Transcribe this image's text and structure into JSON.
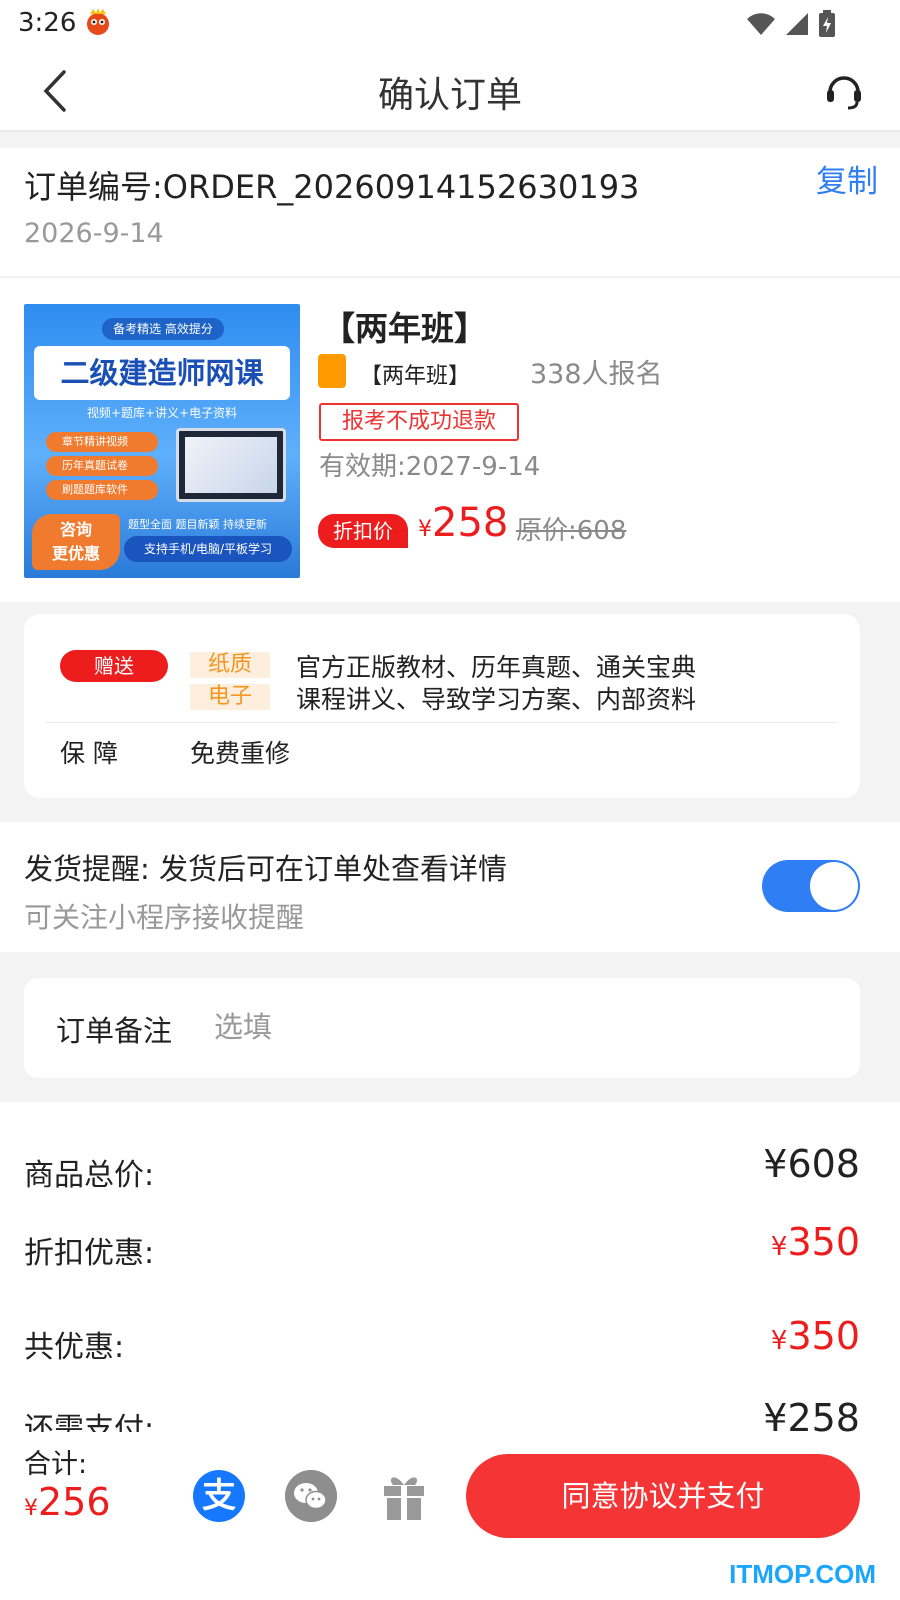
{
  "status_bar": {
    "time": "3:26"
  },
  "nav": {
    "title": "确认订单"
  },
  "order": {
    "number": "订单编号:ORDER_20260914152630193",
    "copy_label": "复制",
    "date": "2026-9-14"
  },
  "product": {
    "image": {
      "tag": "备考精选 高效提分",
      "headline": "二级建造师网课",
      "subline": "视频+题库+讲义+电子资料",
      "bullets": [
        "章节精讲视频",
        "历年真题试卷",
        "刷题题库软件"
      ],
      "promo": "咨询\n更优惠",
      "features": "题型全面 题目新颖 持续更新",
      "support": "支持手机/电脑/平板学习"
    },
    "title": "【两年班】",
    "class_tag": "【两年班】",
    "enrolled": "338人报名",
    "refund_badge": "报考不成功退款",
    "validity": "有效期:2027-9-14",
    "discount_badge": "折扣价",
    "currency": "¥",
    "price": "258",
    "original_price": "原价:608"
  },
  "gift": {
    "badge": "赠送",
    "rows": [
      {
        "kind": "纸质",
        "text": "官方正版教材、历年真题、通关宝典"
      },
      {
        "kind": "电子",
        "text": "课程讲义、导致学习方案、内部资料"
      }
    ],
    "guarantee_label": "保障",
    "guarantee_value": "免费重修"
  },
  "shipping": {
    "title": "发货提醒: 发货后可在订单处查看详情",
    "subtitle": "可关注小程序接收提醒",
    "toggle_on": true
  },
  "remark": {
    "label": "订单备注",
    "placeholder": "选填"
  },
  "summary": {
    "rows": [
      {
        "label": "商品总价:",
        "currency": "",
        "value": "¥608",
        "red": false
      },
      {
        "label": "折扣优惠:",
        "currency": "¥",
        "value": "350",
        "red": true
      },
      {
        "label": "共优惠:",
        "currency": "¥",
        "value": "350",
        "red": true
      },
      {
        "label": "还需支付:",
        "currency": "",
        "value": "¥258",
        "red": false
      }
    ]
  },
  "bottom": {
    "total_label": "合计:",
    "currency": "¥",
    "total": "256",
    "alipay_glyph": "支",
    "pay_button": "同意协议并支付"
  },
  "watermark": "ITMOP.COM",
  "colors": {
    "accent_blue": "#2f7ef4",
    "price_red": "#ee1d1d",
    "pay_button": "#f53535",
    "orange": "#ff9a00"
  }
}
